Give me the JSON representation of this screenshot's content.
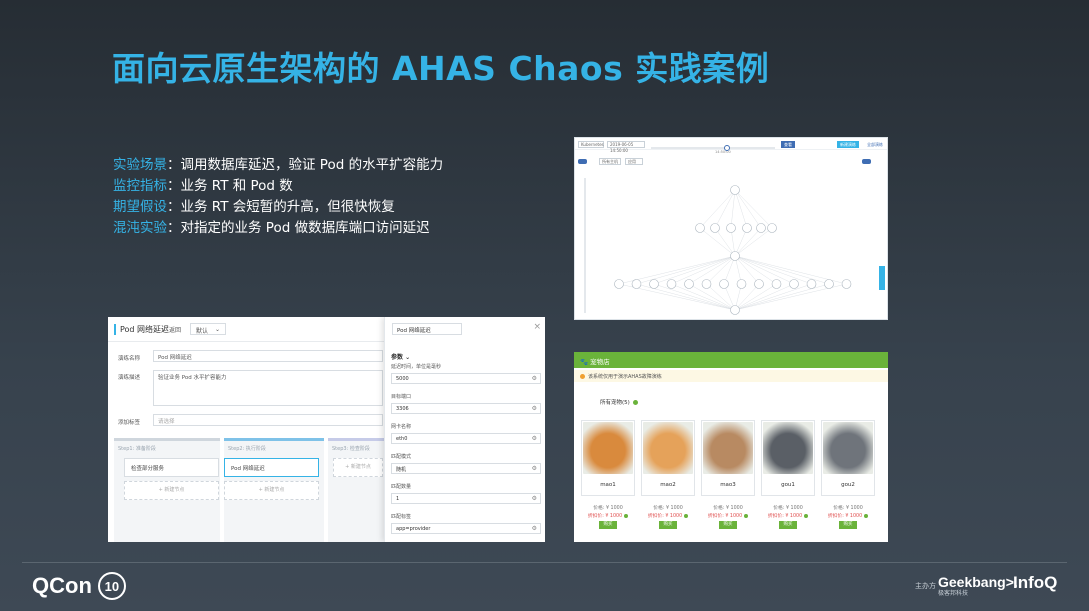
{
  "title": "面向云原生架构的 AHAS Chaos 实践案例",
  "bullets": [
    {
      "key": "实验场景",
      "value": "：调用数据库延迟，验证 Pod 的水平扩容能力"
    },
    {
      "key": "监控指标",
      "value": "：业务 RT 和 Pod 数"
    },
    {
      "key": "期望假设",
      "value": "：业务 RT 会短暂的升高，但很快恢复"
    },
    {
      "key": "混沌实验",
      "value": "：对指定的业务 Pod 做数据库端口访问延迟"
    }
  ],
  "footer": {
    "brand": "QCon",
    "brand_badge": "10",
    "sponsor_label": "主办方",
    "geekbang": "Geekbang>.",
    "geekbang_sub": "极客邦科技",
    "infoq": "InfoQ"
  },
  "topology": {
    "env_select": "Kubernetes",
    "time_text": "2019-06-05 14:50:00",
    "slider_text": "14:50:00",
    "view_button": "查看",
    "node_select_a": "所有主机",
    "node_select_b": "应用",
    "new_button": "新建演练",
    "link": "全部演练"
  },
  "pod_panel": {
    "page_title": "Pod 网络延迟",
    "back": "返回",
    "mode_select": "默认",
    "name_label": "演练名称",
    "name_value": "Pod 网络延迟",
    "desc_label": "演练描述",
    "desc_value": "验证业务 Pod 水平扩容能力",
    "tag_label": "添加标签",
    "tag_placeholder": "请选择",
    "step1": "Step1: 准备阶段",
    "step1_card": "检查部分服务",
    "step2": "Step2: 执行阶段",
    "step2_card": "Pod 网络延迟",
    "step3": "Step3: 检查阶段",
    "add_node": "+ 新建节点",
    "panel_title": "Pod 网络延迟",
    "params": "参数",
    "fields": [
      {
        "label": "延迟时间，单位是毫秒",
        "value": "5000"
      },
      {
        "label": "目标端口",
        "value": "3306"
      },
      {
        "label": "网卡名称",
        "value": "eth0"
      },
      {
        "label": "匹配模式",
        "value": "随机"
      },
      {
        "label": "匹配数量",
        "value": "1"
      },
      {
        "label": "匹配标签",
        "value": "app=provider"
      }
    ]
  },
  "pet_store": {
    "header": "宠物店",
    "notice": "该系统仅用于演示AHAS故障演练",
    "all_pets": "所有宠物(5)",
    "pets": [
      {
        "name": "mao1",
        "price": "价格: ¥ 1000",
        "discount": "折扣价: ¥ 1000",
        "buy": "购买",
        "color": "#d98a3d"
      },
      {
        "name": "mao2",
        "price": "价格: ¥ 1000",
        "discount": "折扣价: ¥ 1000",
        "buy": "购买",
        "color": "#e5a25a"
      },
      {
        "name": "mao3",
        "price": "价格: ¥ 1000",
        "discount": "折扣价: ¥ 1000",
        "buy": "购买",
        "color": "#b88a62"
      },
      {
        "name": "gou1",
        "price": "价格: ¥ 1000",
        "discount": "折扣价: ¥ 1000",
        "buy": "购买",
        "color": "#5a5f66"
      },
      {
        "name": "gou2",
        "price": "价格: ¥ 1000",
        "discount": "折扣价: ¥ 1000",
        "buy": "购买",
        "color": "#6f747b"
      }
    ]
  }
}
